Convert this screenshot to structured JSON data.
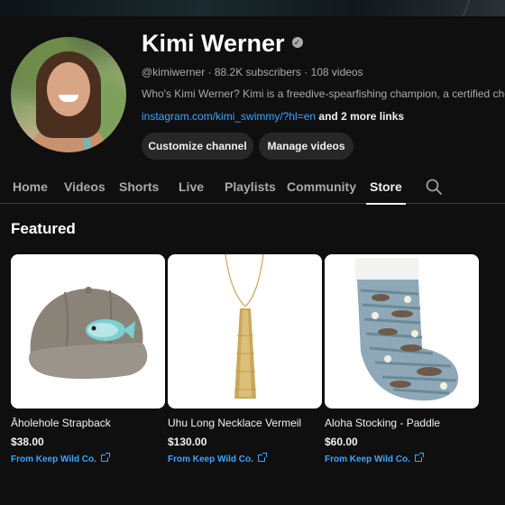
{
  "channel": {
    "title": "Kimi Werner",
    "handle_meta": "@kimiwerner · 88.2K subscribers · 108 videos",
    "description": "Who's Kimi Werner? Kimi is a freedive-spearfishing champion, a certified chef, ar",
    "link": "instagram.com/kimi_swimmy/?hl=en",
    "more_links": "and 2 more links",
    "verified_icon": "check-circle-icon"
  },
  "buttons": {
    "customize": "Customize channel",
    "manage": "Manage videos"
  },
  "tabs": [
    {
      "label": "Home"
    },
    {
      "label": "Videos"
    },
    {
      "label": "Shorts"
    },
    {
      "label": "Live"
    },
    {
      "label": "Playlists"
    },
    {
      "label": "Community"
    },
    {
      "label": "Store"
    }
  ],
  "active_tab": "Store",
  "section": {
    "title": "Featured"
  },
  "products": [
    {
      "name": "Āholehole Strapback",
      "price": "$38.00",
      "vendor": "From Keep Wild Co.",
      "image_icon": "cap-icon"
    },
    {
      "name": "Uhu Long Necklace Vermeil",
      "price": "$130.00",
      "vendor": "From Keep Wild Co.",
      "image_icon": "necklace-icon"
    },
    {
      "name": "Aloha Stocking - Paddle",
      "price": "$60.00",
      "vendor": "From Keep Wild Co.",
      "image_icon": "stocking-icon"
    }
  ],
  "colors": {
    "background": "#0f0f0f",
    "link": "#3ea6ff",
    "button_bg": "#272727",
    "muted_text": "#aaaaaa"
  }
}
